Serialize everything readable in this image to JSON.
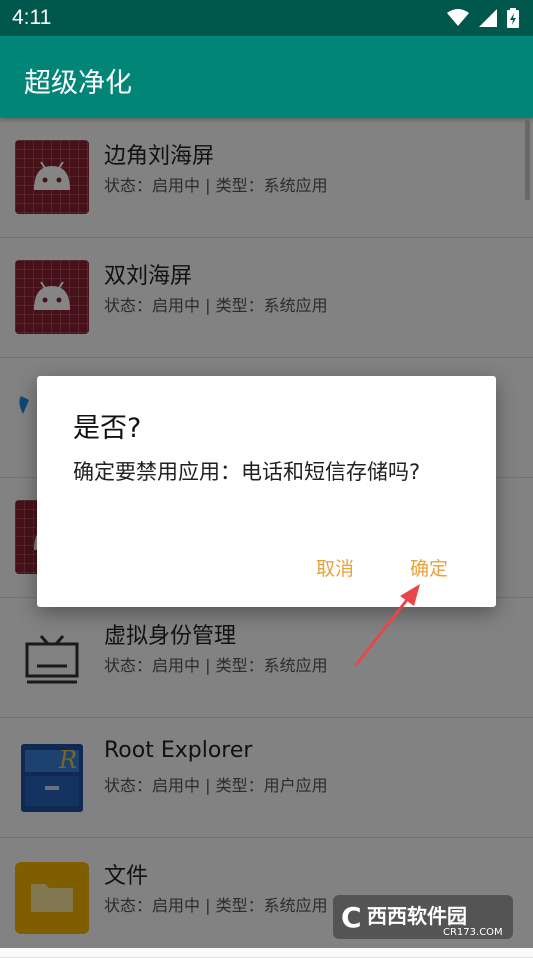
{
  "status_bar": {
    "time": "4:11"
  },
  "app_bar": {
    "title": "超级净化"
  },
  "apps": [
    {
      "name": "边角刘海屏",
      "status": "状态：启用中 | 类型：系统应用"
    },
    {
      "name": "双刘海屏",
      "status": "状态：启用中 | 类型：系统应用"
    },
    {
      "name": "",
      "status": ""
    },
    {
      "name": "",
      "status": ""
    },
    {
      "name": "虚拟身份管理",
      "status": "状态：启用中 | 类型：系统应用"
    },
    {
      "name": "Root Explorer",
      "status": "状态：启用中 | 类型：用户应用"
    },
    {
      "name": "文件",
      "status": "状态：启用中 | 类型：系统应用"
    }
  ],
  "dialog": {
    "title": "是否?",
    "message": "确定要禁用应用：电话和短信存储吗?",
    "cancel_label": "取消",
    "ok_label": "确定"
  },
  "watermark": {
    "main": "西西软件园",
    "sub": "CR173.COM"
  },
  "colors": {
    "primary": "#008577",
    "primary_dark": "#00574b",
    "accent": "#e8a23a"
  },
  "icons": [
    "wifi-icon",
    "signal-icon",
    "battery-icon",
    "android-icon",
    "tv-icon",
    "root-explorer-icon",
    "folder-icon",
    "arrow-annotation"
  ]
}
